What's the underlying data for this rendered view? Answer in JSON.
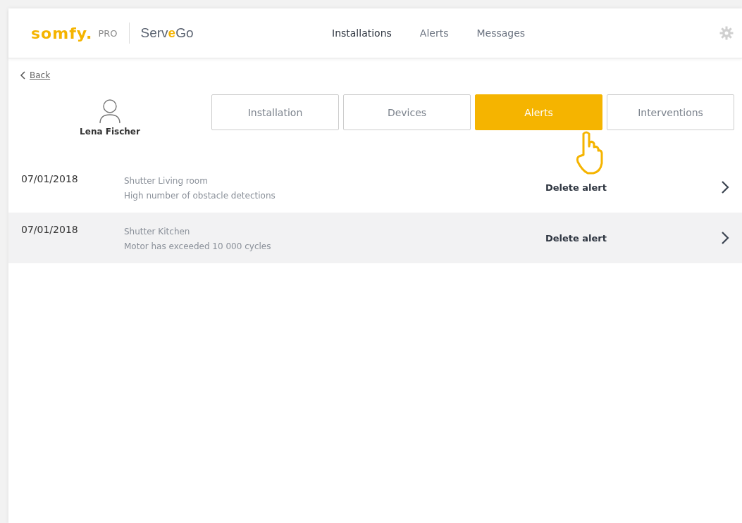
{
  "header": {
    "brand": "somfy.",
    "brand_suffix": "PRO",
    "product": "Serv**e**Go",
    "nav": [
      {
        "label": "Installations",
        "selected": true
      },
      {
        "label": "Alerts",
        "selected": false
      },
      {
        "label": "Messages",
        "selected": false
      }
    ]
  },
  "back": "Back",
  "customer": {
    "name": "Lena Fischer"
  },
  "tabs": [
    {
      "label": "Installation",
      "selected": false
    },
    {
      "label": "Devices",
      "selected": false
    },
    {
      "label": "Alerts",
      "selected": true
    },
    {
      "label": "Interventions",
      "selected": false
    }
  ],
  "alerts": [
    {
      "date": "07/01/2018",
      "device": "Shutter Living room",
      "message": "High number of obstacle detections",
      "action": "Delete alert",
      "selected": false
    },
    {
      "date": "07/01/2018",
      "device": "Shutter Kitchen",
      "message": "Motor has exceeded 10 000 cycles",
      "action": "Delete alert",
      "selected": true
    }
  ]
}
